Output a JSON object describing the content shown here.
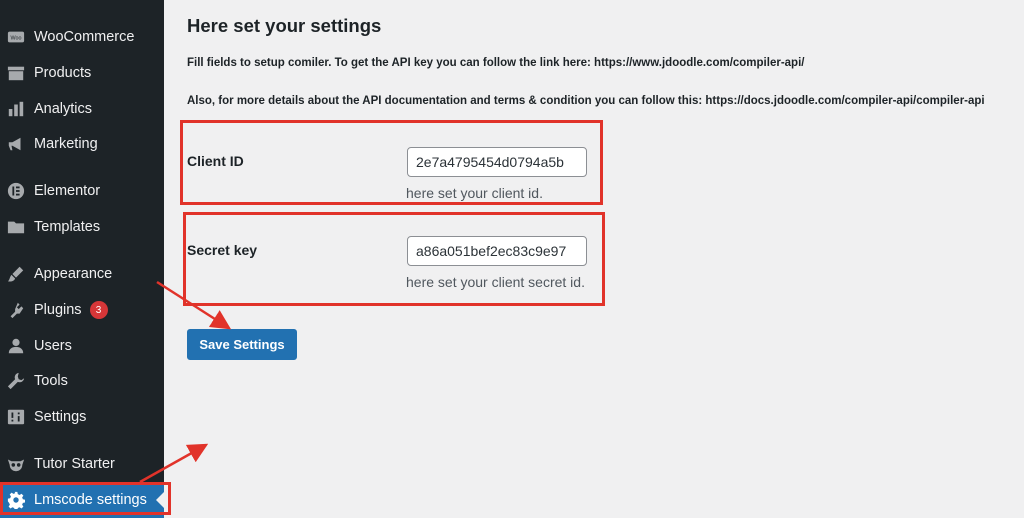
{
  "sidebar": {
    "items": [
      {
        "label": "WooCommerce",
        "icon": "woo-icon"
      },
      {
        "label": "Products",
        "icon": "archive-icon"
      },
      {
        "label": "Analytics",
        "icon": "bar-chart-icon"
      },
      {
        "label": "Marketing",
        "icon": "megaphone-icon"
      },
      {
        "label": "Elementor",
        "icon": "elementor-icon"
      },
      {
        "label": "Templates",
        "icon": "folder-icon"
      },
      {
        "label": "Appearance",
        "icon": "paintbrush-icon"
      },
      {
        "label": "Plugins",
        "icon": "plugin-icon",
        "badge": "3"
      },
      {
        "label": "Users",
        "icon": "user-icon"
      },
      {
        "label": "Tools",
        "icon": "wrench-icon"
      },
      {
        "label": "Settings",
        "icon": "sliders-icon"
      },
      {
        "label": "Tutor Starter",
        "icon": "owl-icon"
      },
      {
        "label": "Lmscode settings",
        "icon": "gear-icon",
        "active": true
      }
    ]
  },
  "main": {
    "title": "Here set your settings",
    "description_1": "Fill fields to setup comiler. To get the API key you can follow the link here: https://www.jdoodle.com/compiler-api/",
    "description_2": "Also, for more details about the API documentation and terms & condition you can follow this: https://docs.jdoodle.com/compiler-api/compiler-api",
    "client_id": {
      "label": "Client ID",
      "value": "2e7a4795454d0794a5b",
      "help": "here set your client id."
    },
    "secret_key": {
      "label": "Secret key",
      "value": "a86a051bef2ec83c9e97",
      "help": "here set your client secret id."
    },
    "save_label": "Save Settings"
  },
  "colors": {
    "sidebar_bg": "#1d2327",
    "accent": "#2271b1",
    "annotation": "#e1332a",
    "badge": "#d63638"
  }
}
